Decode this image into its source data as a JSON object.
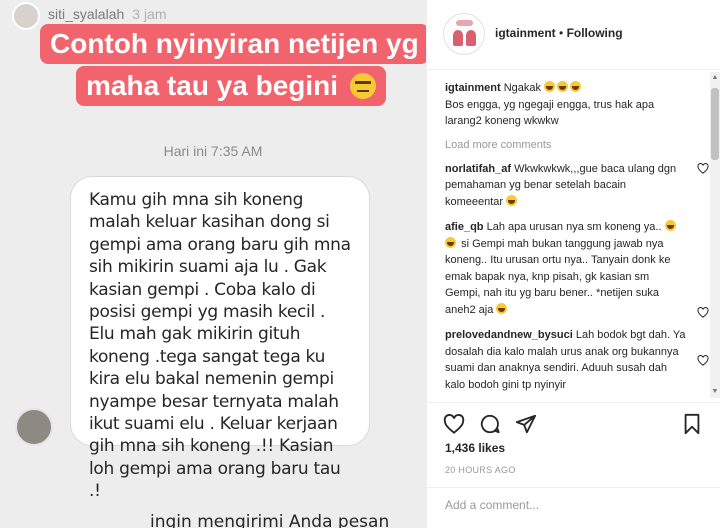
{
  "story": {
    "username": "siti_syalalah",
    "time": "3 jam",
    "caption_line1": "Contoh nyinyiran netijen yg",
    "caption_line2": "maha tau ya begini",
    "day_label": "Hari ini 7:35 AM",
    "message": "Kamu gih mna sih koneng malah keluar kasihan dong si gempi ama orang baru gih mna sih mikirin suami aja lu . Gak kasian gempi . Coba kalo di posisi gempi yg masih kecil . Elu mah gak mikirin gituh koneng .tega sangat tega ku kira elu bakal nemenin gempi nyampe besar ternyata malah ikut suami elu . Keluar kerjaan gih mna sih koneng .!! Kasian loh gempi ama orang baru tau .!",
    "reply_hint": "ingin mengirimi Anda pesan"
  },
  "header": {
    "username": "igtainment",
    "separator": "•",
    "follow_status": "Following"
  },
  "caption": {
    "username": "igtainment",
    "text_before": "Ngakak",
    "text_after": "Bos engga, yg ngegaji engga, trus hak apa larang2 koneng wkwkw"
  },
  "load_more": "Load more comments",
  "comments": [
    {
      "user": "norlatifah_af",
      "text": "Wkwkwkwk,,,gue baca ulang dgn pemahaman yg benar setelah bacain komeeentar"
    },
    {
      "user": "afie_qb",
      "text": "Lah apa urusan nya sm koneng ya..",
      "text_mid": "si Gempi mah bukan tanggung jawab nya koneng.. Itu urusan ortu nya.. Tanyain donk ke emak bapak nya, knp pisah, gk kasian sm Gempi, nah itu yg baru bener.. *netijen suka aneh2 aja"
    },
    {
      "user": "prelovedandnew_bysuci",
      "text": "Lah bodok bgt dah. Ya dosalah dia kalo malah urus anak org bukannya suami dan anaknya sendiri. Aduuh susah dah kalo bodoh gini tp nyinyir"
    }
  ],
  "likes": "1,436 likes",
  "post_time": "20 HOURS AGO",
  "add_comment_placeholder": "Add a comment...",
  "icons": {
    "like": "heart-icon",
    "comment": "comment-icon",
    "share": "share-icon",
    "save": "bookmark-icon"
  }
}
